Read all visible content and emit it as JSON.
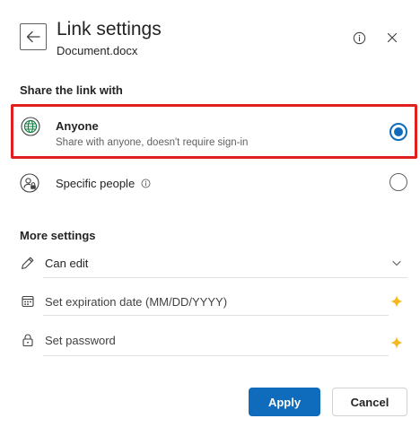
{
  "header": {
    "title": "Link settings",
    "subtitle": "Document.docx",
    "back_icon": "arrow-left-icon",
    "info_icon": "info-icon",
    "close_icon": "close-icon"
  },
  "share": {
    "section_label": "Share the link with",
    "options": [
      {
        "title": "Anyone",
        "description": "Share with anyone, doesn't require sign-in",
        "icon": "globe-icon",
        "selected": true
      },
      {
        "title": "Specific people",
        "description": "",
        "icon": "people-lock-icon",
        "selected": false
      }
    ]
  },
  "more": {
    "section_label": "More settings",
    "permission": {
      "value": "Can edit",
      "icon": "pencil-icon",
      "trail_icon": "chevron-down-icon"
    },
    "expiration": {
      "placeholder": "Set expiration date (MM/DD/YYYY)",
      "icon": "calendar-icon",
      "trail_icon": "sparkle-icon"
    },
    "password": {
      "placeholder": "Set password",
      "icon": "lock-icon",
      "trail_icon": "sparkle-icon"
    }
  },
  "footer": {
    "apply_label": "Apply",
    "cancel_label": "Cancel"
  },
  "colors": {
    "accent": "#0f6cbd",
    "highlight_border": "#e02020",
    "sparkle": "#f5b81e"
  }
}
